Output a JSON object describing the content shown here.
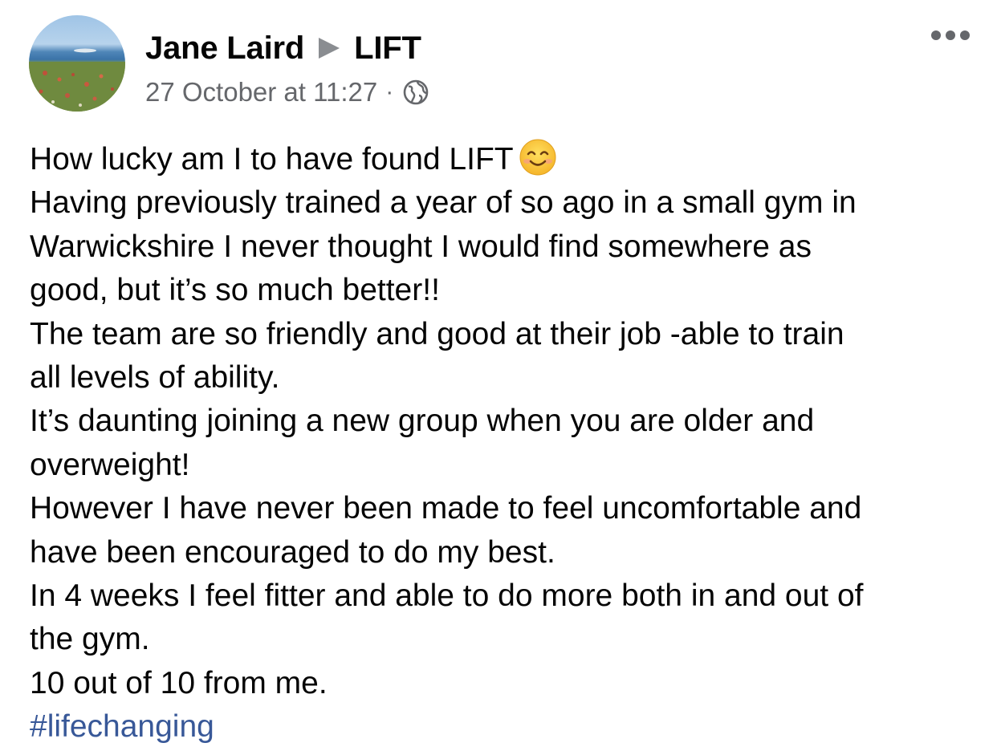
{
  "post": {
    "author": "Jane Laird",
    "target_group": "LIFT",
    "timestamp": "27 October at 11:27",
    "separator": "·",
    "audience_icon": "globe-icon",
    "more_icon": "more-options-icon",
    "lines": [
      "How lucky am I to have found LIFT",
      "Having previously trained a year of so ago in a small gym in",
      "Warwickshire I never thought I would find somewhere as",
      "good, but it’s so much better!!",
      "The team are so friendly and good at their job -able to train",
      "all levels of ability.",
      "It’s daunting joining a new group when you are older and",
      "overweight!",
      "However I have never been made to feel uncomfortable and",
      "have been encouraged to do my best.",
      "In 4 weeks I feel fitter and able to do more both in and out of",
      "the gym.",
      "10 out of 10 from me."
    ],
    "emoji": "smiling-face-icon",
    "hashtag": "#lifechanging"
  },
  "colors": {
    "text": "#050505",
    "secondary": "#65676b",
    "link": "#385898",
    "arrow": "#8a8d91"
  }
}
